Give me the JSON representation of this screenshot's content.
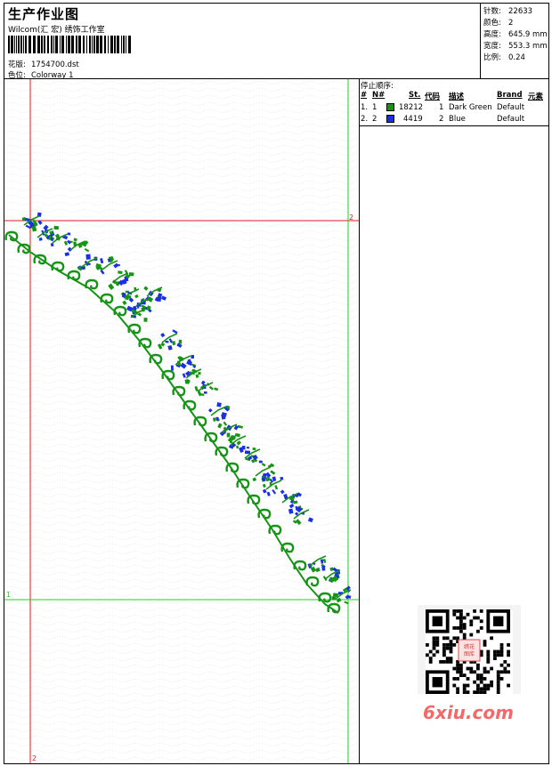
{
  "header": {
    "title": "生产作业图",
    "company": "Wilcom(汇 宏) 绣饰工作室",
    "pattern_label": "花版:",
    "pattern_value": "1754700.dst",
    "color_label": "色位:",
    "color_value": "Colorway 1"
  },
  "stats": {
    "stitches_label": "针数:",
    "stitches_value": "22633",
    "colors_label": "颜色:",
    "colors_value": "2",
    "height_label": "高度:",
    "height_value": "645.9 mm",
    "width_label": "宽度:",
    "width_value": "553.3 mm",
    "scale_label": "比例:",
    "scale_value": "0.24"
  },
  "stop_sequence": {
    "title": "停止顺序:",
    "headers": [
      "#",
      "N#",
      "St.",
      "代码",
      "描述",
      "Brand",
      "元素"
    ],
    "rows": [
      {
        "idx": "1.",
        "n": "1",
        "swatch": "#159415",
        "stitches": "18212",
        "code": "1",
        "description": "Dark Green",
        "brand": "Default"
      },
      {
        "idx": "2.",
        "n": "2",
        "swatch": "#1a2fe6",
        "stitches": "4419",
        "code": "2",
        "description": "Blue",
        "brand": "Default"
      }
    ]
  },
  "canvas": {
    "guide_label_top": "2",
    "guide_label_bottom": "1",
    "guide_label_foot": "2",
    "colors": {
      "green_guide": "#19d419",
      "red_guide": "#e01818",
      "thread_green": "#159415",
      "thread_blue": "#1a2fe6"
    }
  },
  "watermark": {
    "text": "6xiu.com",
    "qr_caption": "绣花图库"
  }
}
